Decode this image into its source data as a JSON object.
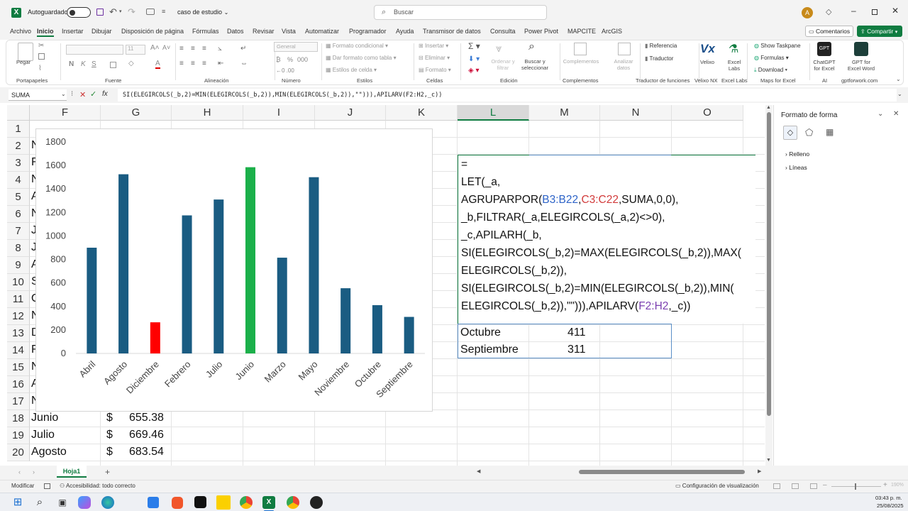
{
  "titlebar": {
    "autosave_label": "Autoguardado",
    "autosave_state": "off",
    "filename": "caso de estudio",
    "search_placeholder": "Buscar",
    "avatar_initial": "A"
  },
  "ribbon_tabs": [
    {
      "label": "Archivo"
    },
    {
      "label": "Inicio",
      "active": true
    },
    {
      "label": "Insertar"
    },
    {
      "label": "Dibujar"
    },
    {
      "label": "Disposición de página"
    },
    {
      "label": "Fórmulas"
    },
    {
      "label": "Datos"
    },
    {
      "label": "Revisar"
    },
    {
      "label": "Vista"
    },
    {
      "label": "Automatizar"
    },
    {
      "label": "Programador"
    },
    {
      "label": "Ayuda"
    },
    {
      "label": "Transmisor de datos"
    },
    {
      "label": "Consulta"
    },
    {
      "label": "Power Pivot"
    },
    {
      "label": "MAPCITE"
    },
    {
      "label": "ArcGIS"
    }
  ],
  "comments_label": "Comentarios",
  "share_label": "Compartir",
  "ribbon": {
    "groups": [
      "Portapapeles",
      "Fuente",
      "Alineación",
      "Número",
      "Estilos",
      "Celdas",
      "Edición",
      "Complementos",
      "Traductor de funciones",
      "Velixo NX",
      "Excel Labs",
      "Maps for Excel",
      "AI",
      "gptforwork.com"
    ],
    "paste": "Pegar",
    "number_format": "General",
    "font_size": "11",
    "conditional_format": "Formato condicional",
    "format_as_table": "Dar formato como tabla",
    "cell_styles": "Estilos de celda",
    "insert": "Insertar",
    "delete": "Eliminar",
    "format": "Formato",
    "sort_filter": "Ordenar y filtrar",
    "find_select": "Buscar y seleccionar",
    "addins": "Complementos",
    "analyze_data": "Analizar datos",
    "reference": "Referencia",
    "translator": "Traductor",
    "velixo": "Velixo",
    "excel_labs": "Excel Labs",
    "show_taskpane": "Show Taskpane",
    "formulas": "Formulas",
    "download": "Download",
    "chatgpt": "ChatGPT for Excel",
    "gpt_word": "GPT for Excel Word"
  },
  "formula_bar": {
    "name_box": "SUMA",
    "fx": "fx",
    "formula": "SI(ELEGIRCOLS(_b,2)=MIN(ELEGIRCOLS(_b,2)),MIN(ELEGIRCOLS(_b,2)),\"\"))),APILARV(F2:H2,_c))"
  },
  "columns": [
    "F",
    "G",
    "H",
    "I",
    "J",
    "K",
    "L",
    "M",
    "N",
    "O"
  ],
  "rows": [
    "1",
    "2",
    "3",
    "4",
    "5",
    "6",
    "7",
    "8",
    "9",
    "10",
    "11",
    "12",
    "13",
    "14",
    "15",
    "16",
    "17",
    "18",
    "19",
    "20"
  ],
  "left_cells": {
    "2": "N",
    "3": "F",
    "4": "N",
    "5": "A",
    "6": "N",
    "7": "J",
    "8": "J",
    "9": "A",
    "10": "S",
    "11": "O",
    "12": "N",
    "13": "D",
    "14": "F",
    "15": "N",
    "16": "A",
    "17": "N"
  },
  "data_rows": [
    {
      "row": "18",
      "month": "Junio",
      "currency": "$",
      "value": "655.38"
    },
    {
      "row": "19",
      "month": "Julio",
      "currency": "$",
      "value": "669.46"
    },
    {
      "row": "20",
      "month": "Agosto",
      "currency": "$",
      "value": "683.54"
    }
  ],
  "edit_formula_lines": [
    [
      {
        "t": "="
      }
    ],
    [
      {
        "t": "LET(_a,"
      }
    ],
    [
      {
        "t": "AGRUPARPOR("
      },
      {
        "t": "B3:B22",
        "c": "#2e64c8"
      },
      {
        "t": ","
      },
      {
        "t": "C3:C22",
        "c": "#d23c3c"
      },
      {
        "t": ",SUMA,0,0),"
      }
    ],
    [
      {
        "t": "_b,FILTRAR(_a,ELEGIRCOLS(_a,2)<>0),"
      }
    ],
    [
      {
        "t": "_c,APILARH(_b,"
      }
    ],
    [
      {
        "t": "SI(ELEGIRCOLS(_b,2)=MAX(ELEGIRCOLS(_b,2)),MAX("
      }
    ],
    [
      {
        "t": "ELEGIRCOLS(_b,2)),"
      }
    ],
    [
      {
        "t": "SI(ELEGIRCOLS(_b,2)=MIN(ELEGIRCOLS(_b,2)),MIN("
      }
    ],
    [
      {
        "t": "ELEGIRCOLS(_b,2)),\"\"))),APILARV("
      },
      {
        "t": "F2:H2",
        "c": "#7b3fb0"
      },
      {
        "t": ",_c))"
      }
    ]
  ],
  "spill_rows": [
    {
      "label": "Octubre",
      "value": "411"
    },
    {
      "label": "Septiembre",
      "value": "311"
    }
  ],
  "chart_data": {
    "type": "bar",
    "categories": [
      "Abril",
      "Agosto",
      "Diciembre",
      "Febrero",
      "Julio",
      "Junio",
      "Marzo",
      "Mayo",
      "Noviembre",
      "Octubre",
      "Septiembre"
    ],
    "values": [
      900,
      1525,
      265,
      1175,
      1310,
      1585,
      815,
      1500,
      555,
      411,
      311
    ],
    "bar_colors": [
      "#1a5c82",
      "#1a5c82",
      "#ff0000",
      "#1a5c82",
      "#1a5c82",
      "#1bb04a",
      "#1a5c82",
      "#1a5c82",
      "#1a5c82",
      "#1a5c82",
      "#1a5c82"
    ],
    "yticks": [
      "0",
      "200",
      "400",
      "600",
      "800",
      "1000",
      "1200",
      "1400",
      "1600",
      "1800"
    ],
    "ylim": [
      0,
      1800
    ],
    "title": "",
    "xlabel": "",
    "ylabel": "",
    "grid": false,
    "legend": "none"
  },
  "format_pane": {
    "title": "Formato de forma",
    "sections": [
      "Relleno",
      "Líneas"
    ]
  },
  "sheet_tab": "Hoja1",
  "status": {
    "mode": "Modificar",
    "accessibility": "Accesibilidad: todo correcto",
    "view_settings": "Configuración de visualización",
    "zoom": "190%"
  },
  "taskbar": {
    "time": "03:43 p. m.",
    "date": "25/08/2025"
  }
}
